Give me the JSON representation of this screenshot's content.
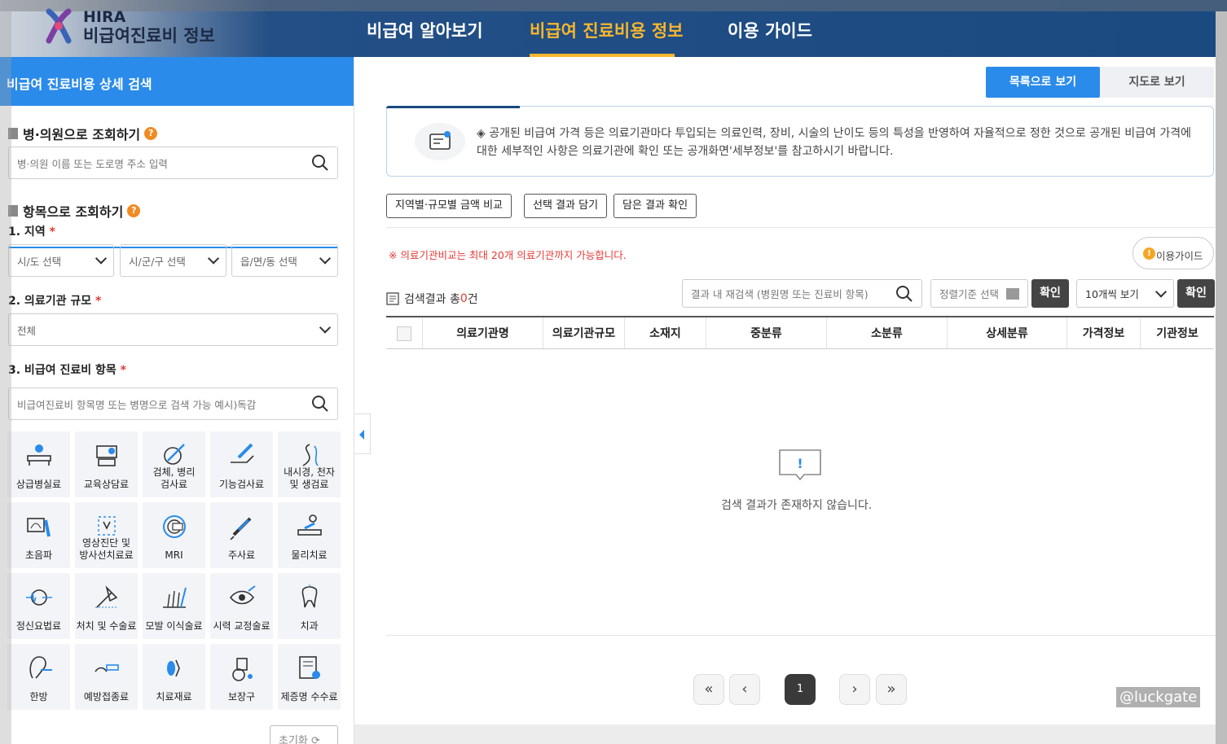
{
  "header": {
    "logo_top": "HIRA",
    "logo_bottom": "비급여진료비 정보",
    "nav": [
      "비급여 알아보기",
      "비급여 진료비용 정보",
      "이용 가이드"
    ],
    "active_color": "#f7b62d"
  },
  "sidebar": {
    "title": "비급여 진료비용 상세 검색",
    "hospital_section": {
      "title": "병·의원으로 조회하기",
      "placeholder": "병·의원 이름 또는 도로명 주소 입력"
    },
    "item_section": {
      "title": "항목으로 조회하기",
      "region_label": "1. 지역",
      "region_selects": [
        "시/도 선택",
        "시/군/구 선택",
        "읍/면/동 선택"
      ],
      "scale_label": "2. 의료기관 규모",
      "scale_value": "전체",
      "item_label": "3. 비급여 진료비 항목",
      "item_placeholder": "비급여진료비 항목명 또는 병명으로 검색 가능 예시)독감",
      "required_mark": "*"
    },
    "categories": [
      {
        "label": "상급병실료",
        "icon": "hospital-bed-icon"
      },
      {
        "label": "교육상담료",
        "icon": "consultation-icon"
      },
      {
        "label": "검체, 병리\n검사료",
        "icon": "specimen-test-icon"
      },
      {
        "label": "기능검사료",
        "icon": "function-test-icon"
      },
      {
        "label": "내시경, 천자\n및 생검료",
        "icon": "endoscope-icon"
      },
      {
        "label": "초음파",
        "icon": "ultrasound-icon"
      },
      {
        "label": "영상진단 및\n방사선치료료",
        "icon": "radiology-icon"
      },
      {
        "label": "MRI",
        "icon": "mri-icon"
      },
      {
        "label": "주사료",
        "icon": "injection-icon"
      },
      {
        "label": "물리치료",
        "icon": "physical-therapy-icon"
      },
      {
        "label": "정신요법료",
        "icon": "psychotherapy-icon"
      },
      {
        "label": "처치 및 수술료",
        "icon": "surgery-icon"
      },
      {
        "label": "모발 이식술료",
        "icon": "hair-transplant-icon"
      },
      {
        "label": "시력 교정술료",
        "icon": "eye-correction-icon"
      },
      {
        "label": "치과",
        "icon": "tooth-icon"
      },
      {
        "label": "한방",
        "icon": "oriental-medicine-icon"
      },
      {
        "label": "예방접종료",
        "icon": "vaccination-icon"
      },
      {
        "label": "치료재료",
        "icon": "treatment-material-icon"
      },
      {
        "label": "보장구",
        "icon": "wheelchair-icon"
      },
      {
        "label": "제증명 수수료",
        "icon": "certificate-icon"
      }
    ],
    "reset_label": "초기화"
  },
  "main": {
    "view_list": "목록으로 보기",
    "view_map": "지도로 보기",
    "notice": "◈ 공개된 비급여 가격 등은 의료기관마다 투입되는 의료인력, 장비, 시술의 난이도 등의 특성을 반영하여 자율적으로 정한 것으로 공개된 비급여 가격에 대한 세부적인 사항은 의료기관에 확인 또는 공개화면'세부정보'를 참고하시기 바랍니다.",
    "actions": [
      "지역별·규모별 금액 비교",
      "선택 결과 담기",
      "담은 결과 확인"
    ],
    "warning": "※ 의료기관비교는 최대 20개 의료기관까지 가능합니다.",
    "guide": "이용가이드",
    "result_prefix": "검색결과 총",
    "result_count": "0",
    "result_suffix": "건",
    "refine_placeholder": "결과 내 재검색 (병원명 또는 진료비 항목)",
    "sort_placeholder": "정렬기준 선택",
    "confirm": "확인",
    "per_page": "10개씩 보기",
    "columns": [
      "의료기관명",
      "의료기관규모",
      "소재지",
      "중분류",
      "소분류",
      "상세분류",
      "가격정보",
      "기관정보"
    ],
    "empty_message": "검색 결과가 존재하지 않습니다.",
    "pagination": {
      "current": "1"
    },
    "watermark": "@luckgate"
  }
}
